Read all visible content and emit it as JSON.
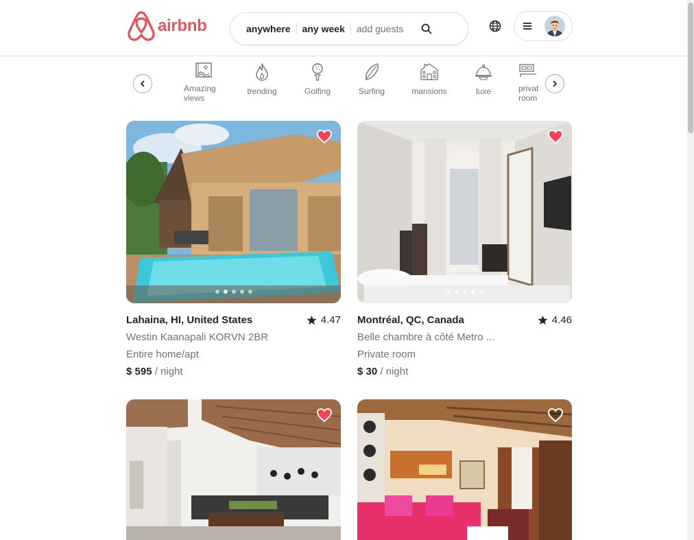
{
  "brand": {
    "name": "airbnb",
    "color": "#e0565b"
  },
  "search": {
    "location": "anywhere",
    "dates": "any week",
    "guests": "add guests"
  },
  "icons": {
    "search": "search-icon",
    "globe": "globe-icon",
    "menu": "menu-icon"
  },
  "categories": {
    "items": [
      {
        "label": "Amazing views",
        "icon": "amazing-views-icon"
      },
      {
        "label": "trending",
        "icon": "flame-icon"
      },
      {
        "label": "Golfing",
        "icon": "golf-icon"
      },
      {
        "label": "Surfing",
        "icon": "surfboard-icon"
      },
      {
        "label": "mansions",
        "icon": "mansion-icon"
      },
      {
        "label": "luxe",
        "icon": "cloche-icon"
      },
      {
        "label": "private room",
        "icon": "bed-icon"
      }
    ]
  },
  "listings": [
    {
      "location": "Lahaina, HI, United States",
      "rating": "4.47",
      "title": "Westin Kaanapali KORVN 2BR",
      "type": "Entire home/apt",
      "price": "$ 595",
      "unit": "/ night",
      "favorited": true
    },
    {
      "location": "Montréal, QC, Canada",
      "rating": "4.46",
      "title": "Belle chambre à côté Metro ...",
      "type": "Private room",
      "price": "$ 30",
      "unit": "/ night",
      "favorited": true
    },
    {
      "favorited": true
    },
    {
      "favorited": false
    }
  ]
}
